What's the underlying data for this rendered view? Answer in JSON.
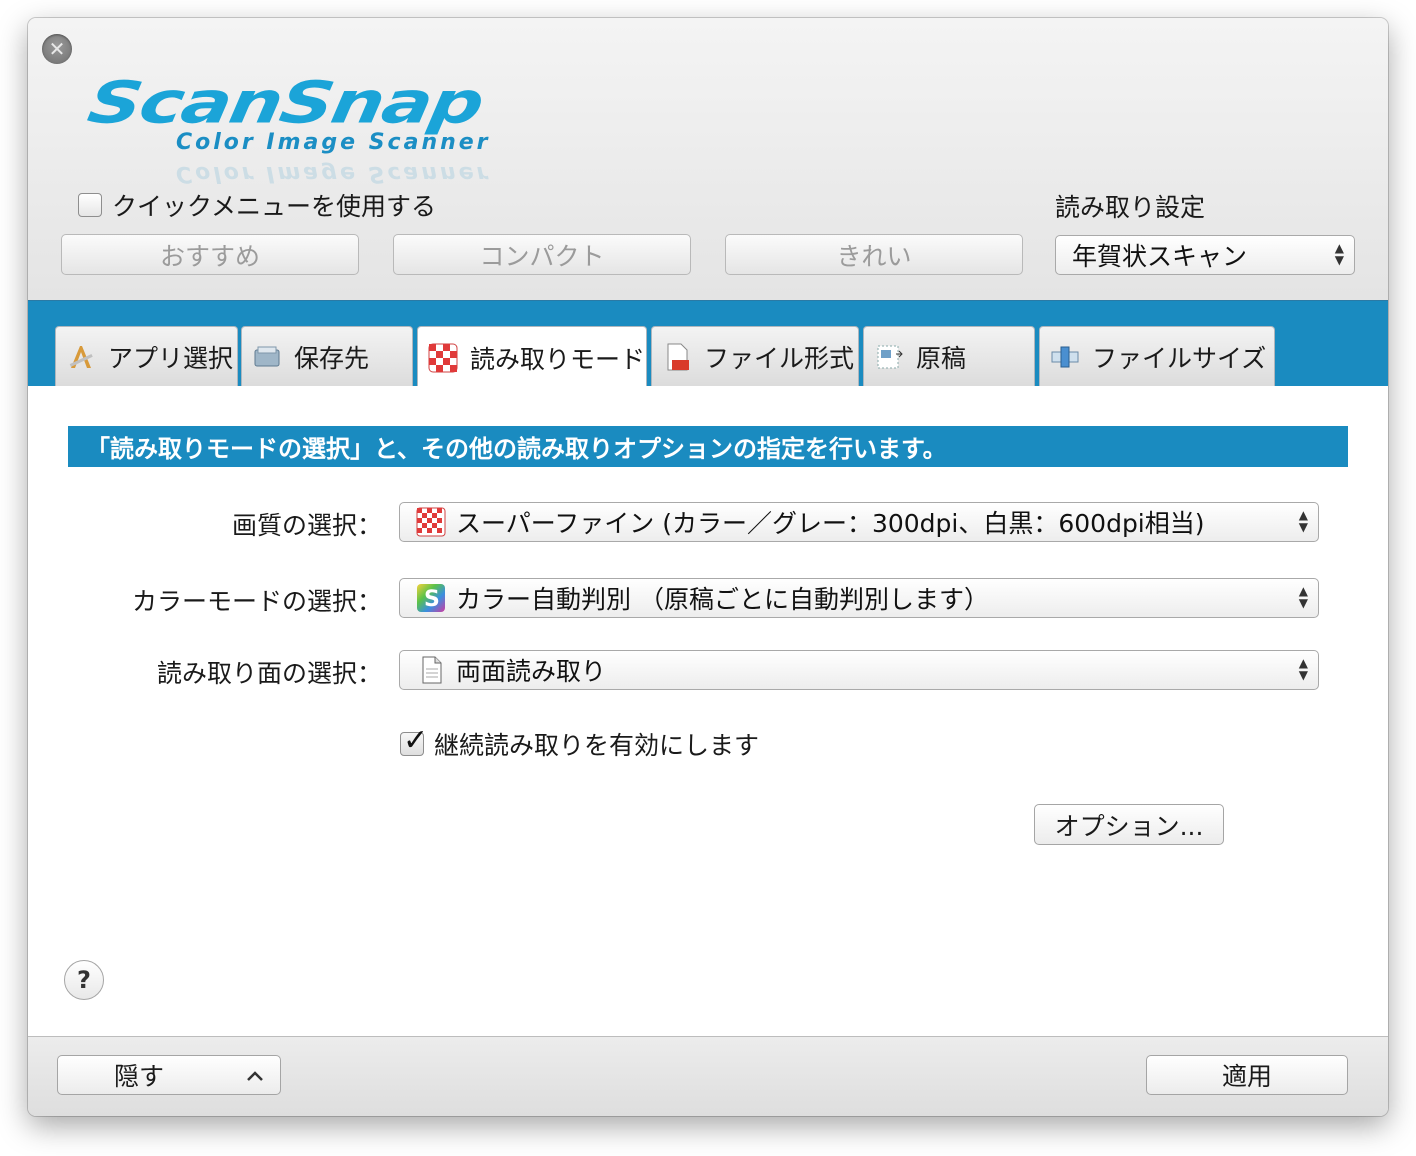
{
  "window": {
    "close_icon": "close-icon"
  },
  "logo": {
    "brand": "ScanSnap",
    "tagline": "Color Image Scanner"
  },
  "header": {
    "quick_menu_label": "クイックメニューを使用する",
    "quick_menu_checked": false,
    "scan_setting_label": "読み取り設定",
    "scan_setting_value": "年賀状スキャン",
    "presets": [
      "おすすめ",
      "コンパクト",
      "きれい"
    ]
  },
  "tabs": [
    {
      "label": "アプリ選択",
      "icon": "app-select-icon",
      "active": false
    },
    {
      "label": "保存先",
      "icon": "save-location-icon",
      "active": false
    },
    {
      "label": "読み取りモード",
      "icon": "checkerboard-icon",
      "active": true
    },
    {
      "label": "ファイル形式",
      "icon": "pdf-file-icon",
      "active": false
    },
    {
      "label": "原稿",
      "icon": "paper-icon",
      "active": false
    },
    {
      "label": "ファイルサイズ",
      "icon": "file-size-icon",
      "active": false
    }
  ],
  "content": {
    "info_text": "「読み取りモードの選択」と、その他の読み取りオプションの指定を行います。",
    "quality_label": "画質の選択：",
    "quality_value": "スーパーファイン (カラー／グレー：300dpi、白黒：600dpi相当)",
    "color_mode_label": "カラーモードの選択：",
    "color_mode_value": "カラー自動判別 （原稿ごとに自動判別します）",
    "scan_side_label": "読み取り面の選択：",
    "scan_side_value": "両面読み取り",
    "continuous_label": "継続読み取りを有効にします",
    "continuous_checked": true,
    "options_button": "オプション...",
    "help_button": "?"
  },
  "footer": {
    "hide_button": "隠す",
    "hide_icon": "chevron-up-icon",
    "apply_button": "適用"
  },
  "colors": {
    "accent_blue": "#1a8bc0",
    "logo_blue": "#1ba4d8"
  }
}
